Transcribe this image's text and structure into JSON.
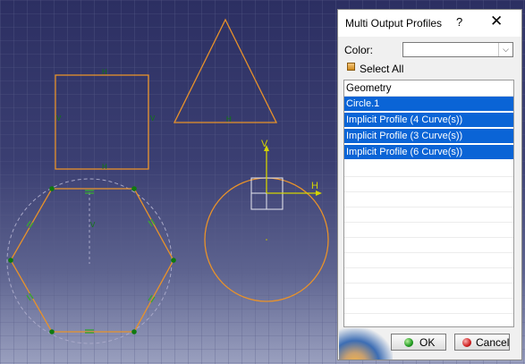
{
  "dialog": {
    "title": "Multi Output Profiles",
    "help_label": "?",
    "close_label": "✕",
    "color_label": "Color:",
    "color_value": "",
    "select_all_label": "Select All",
    "list_header": "Geometry",
    "items": [
      {
        "label": "Circle.1",
        "selected": true
      },
      {
        "label": "Implicit Profile (4 Curve(s))",
        "selected": true
      },
      {
        "label": "Implicit Profile (3 Curve(s))",
        "selected": true
      },
      {
        "label": "Implicit Profile (6 Curve(s))",
        "selected": true
      }
    ],
    "ok_label": "OK",
    "cancel_label": "Cancel"
  },
  "sketch": {
    "constraint_h": "H",
    "constraint_v": "V",
    "axis_h": "H",
    "axis_v": "V"
  },
  "colors": {
    "profile": "#e8922a",
    "selection": "#0a64d6",
    "background_top": "#2c2f62",
    "background_bottom": "#9aa0bf",
    "axis": "#d4d400",
    "constraint_marker": "#0f7a0f"
  }
}
